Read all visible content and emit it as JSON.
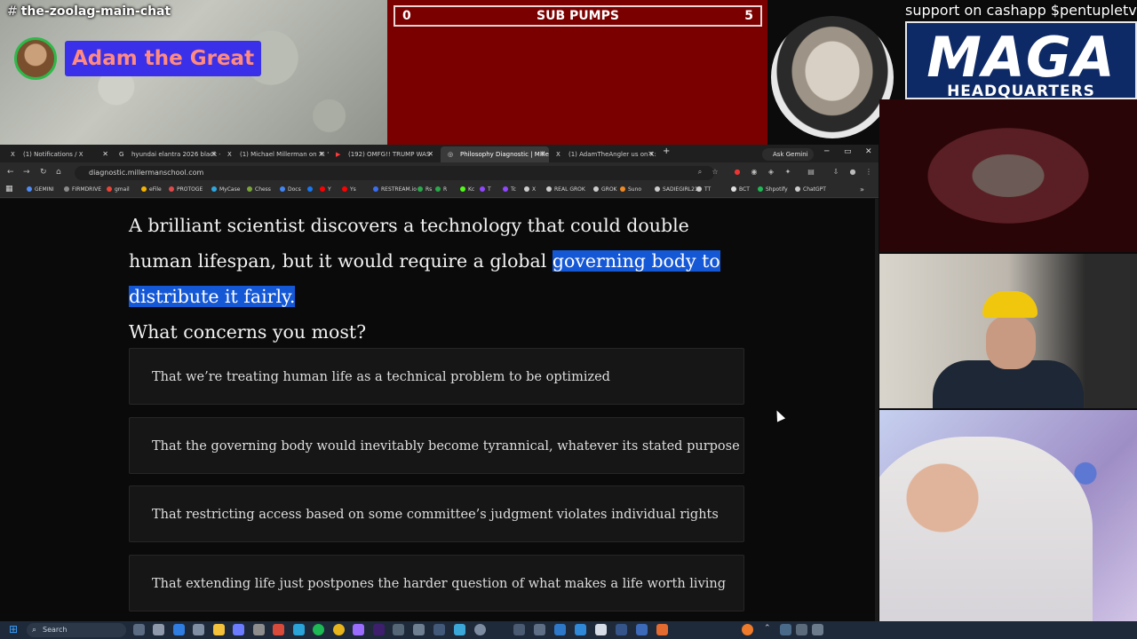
{
  "discord": {
    "channel_hash": "#",
    "channel": "the-zoolag-main-chat",
    "speaker_name": "Adam the Great"
  },
  "scoreboard": {
    "left_score": "0",
    "title": "SUB PUMPS",
    "right_score": "5"
  },
  "banner": {
    "support_text": "support on cashapp $pentupletv",
    "maga_big": "MAGA",
    "maga_small": "HEADQUARTERS"
  },
  "browser": {
    "tabs": [
      {
        "label": "(1) Notifications / X",
        "icon": "X"
      },
      {
        "label": "hyundai elantra 2026 black - G",
        "icon": "G"
      },
      {
        "label": "(1) Michael Millerman on X: \"A",
        "icon": "X"
      },
      {
        "label": "(192) OMFG!! TRUMP WAS",
        "icon": "▶"
      },
      {
        "label": "Philosophy Diagnostic | Millerm",
        "icon": "◎"
      },
      {
        "label": "(1) AdamTheAngler us on X: \"Lo",
        "icon": "X"
      }
    ],
    "new_tab": "+",
    "ask_gemini": "Ask Gemini",
    "url": "diagnostic.millermanschool.com",
    "bookmarks": [
      {
        "label": "GEMINI",
        "color": "#4f8cf5"
      },
      {
        "label": "FIRMDRIVE",
        "color": "#8a8a8a"
      },
      {
        "label": "gmail",
        "color": "#ea4335"
      },
      {
        "label": "eFile",
        "color": "#f4b400"
      },
      {
        "label": "PROTOGE",
        "color": "#e04a4a"
      },
      {
        "label": "MyCase",
        "color": "#2ea7e0"
      },
      {
        "label": "Chess",
        "color": "#7aa43a"
      },
      {
        "label": "Docs",
        "color": "#4285f4"
      },
      {
        "label": "",
        "color": "#1877f2"
      },
      {
        "label": "Y",
        "color": "#ff0000"
      },
      {
        "label": "Ys",
        "color": "#ff0000"
      },
      {
        "label": "RESTREAM.io",
        "color": "#3b6df0"
      },
      {
        "label": "Rs",
        "color": "#2aa84a"
      },
      {
        "label": "R",
        "color": "#2aa84a"
      },
      {
        "label": "Kc",
        "color": "#53fc18"
      },
      {
        "label": "T",
        "color": "#9146ff"
      },
      {
        "label": "Tc",
        "color": "#9146ff"
      },
      {
        "label": "X",
        "color": "#cccccc"
      },
      {
        "label": "REAL GROK",
        "color": "#cccccc"
      },
      {
        "label": "GROK",
        "color": "#cccccc"
      },
      {
        "label": "Suno",
        "color": "#f08a24"
      },
      {
        "label": "SADIEGIRL216",
        "color": "#cccccc"
      },
      {
        "label": "TT",
        "color": "#cccccc"
      },
      {
        "label": "BCT",
        "color": "#e0e0e0"
      },
      {
        "label": "Shpotify",
        "color": "#1db954"
      },
      {
        "label": "ChatGPT",
        "color": "#cccccc"
      }
    ]
  },
  "page": {
    "question_before": "A brilliant scientist discovers a technology that could double human lifespan, but it would require a global",
    "question_highlight": "governing body to distribute it fairly.",
    "question_after": "What concerns you most?",
    "answers": [
      "That we’re treating human life as a technical problem to be optimized",
      "That the governing body would inevitably become tyrannical, whatever its stated purpose",
      "That restricting access based on some committee’s judgment violates individual rights",
      "That extending life just postpones the harder question of what makes a life worth living"
    ]
  },
  "taskbar": {
    "search_placeholder": "Search"
  },
  "colors": {
    "highlight": "#1558d6",
    "score_bg": "#7a0000",
    "discord_name_bg": "#3a30ea"
  }
}
